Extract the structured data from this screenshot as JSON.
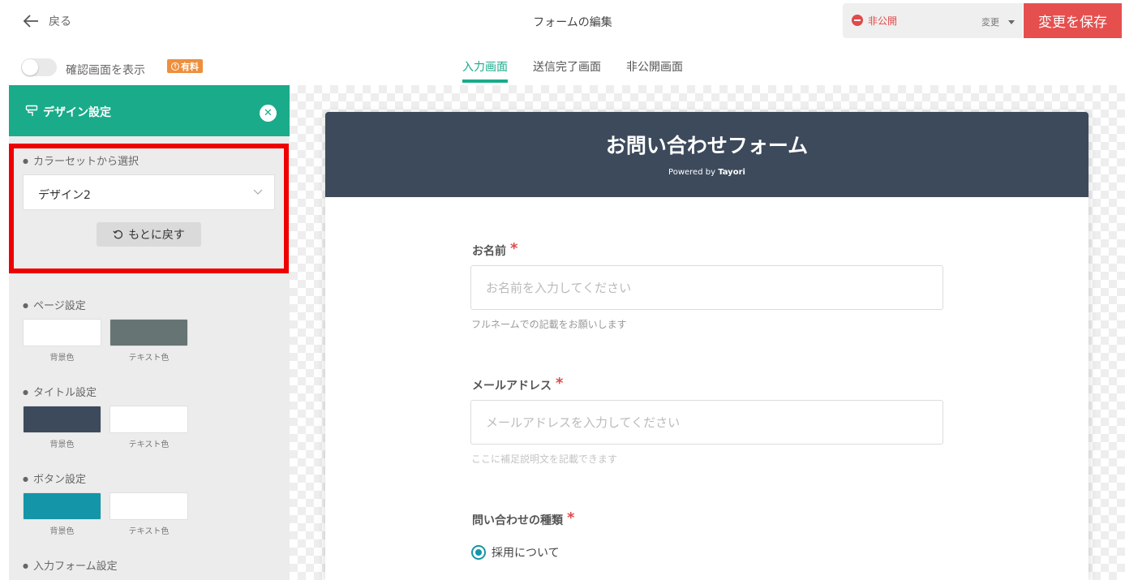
{
  "header": {
    "back_label": "戻る",
    "page_title": "フォームの編集",
    "status_label": "非公開",
    "change_label": "変更",
    "save_label": "変更を保存"
  },
  "toolbar": {
    "confirm_toggle_label": "確認画面を表示",
    "paid_badge": "有料",
    "confirm_toggle_on": false
  },
  "tabs": [
    {
      "label": "入力画面",
      "active": true
    },
    {
      "label": "送信完了画面",
      "active": false
    },
    {
      "label": "非公開画面",
      "active": false
    }
  ],
  "sidebar": {
    "title": "デザイン設定",
    "color_set_label": "カラーセットから選択",
    "color_set_value": "デザイン2",
    "reset_label": "もとに戻す",
    "sections": [
      {
        "label": "ページ設定",
        "bg_caption": "背景色",
        "text_caption": "テキスト色",
        "bg_color": "#ffffff",
        "text_color": "#667573"
      },
      {
        "label": "タイトル設定",
        "bg_caption": "背景色",
        "text_caption": "テキスト色",
        "bg_color": "#3d4a5c",
        "text_color": "#ffffff"
      },
      {
        "label": "ボタン設定",
        "bg_caption": "背景色",
        "text_caption": "テキスト色",
        "bg_color": "#1495a8",
        "text_color": "#ffffff"
      }
    ],
    "input_section_label": "入力フォーム設定"
  },
  "form": {
    "title": "お問い合わせフォーム",
    "powered_prefix": "Powered by",
    "powered_brand": "Tayori",
    "fields": [
      {
        "label": "お名前",
        "required_mark": "*",
        "placeholder": "お名前を入力してください",
        "help": "フルネームでの記載をお願いします"
      },
      {
        "label": "メールアドレス",
        "required_mark": "*",
        "placeholder": "メールアドレスを入力してください",
        "help": "ここに補足説明文を記載できます"
      },
      {
        "label": "問い合わせの種類",
        "required_mark": "*"
      }
    ],
    "radio_option": "採用について"
  },
  "colors": {
    "accent": "#1aab8a",
    "save": "#e5504f",
    "highlight": "#ee0000",
    "form_header": "#3d4a5c"
  }
}
